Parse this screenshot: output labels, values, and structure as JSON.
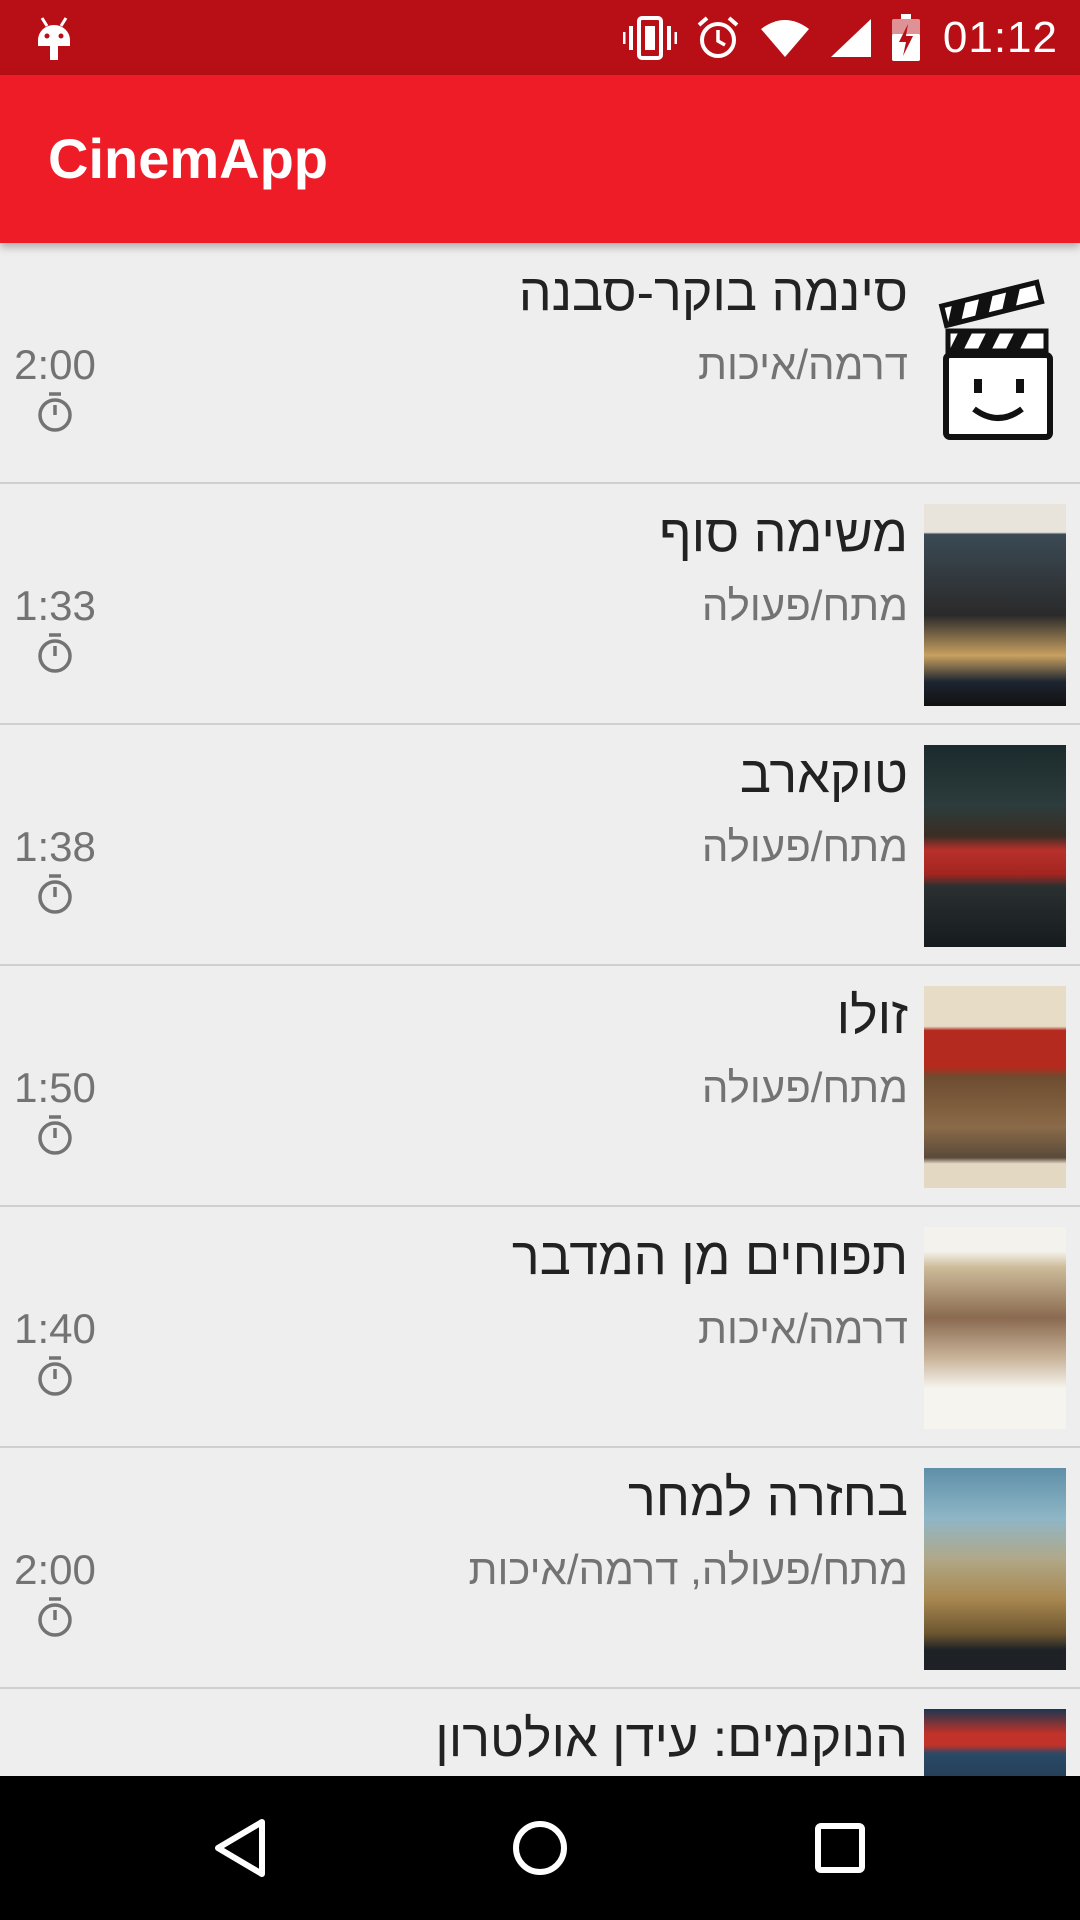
{
  "status_bar": {
    "time": "01:12",
    "icons": [
      "android-debug-icon",
      "vibrate-icon",
      "alarm-icon",
      "wifi-icon",
      "signal-icon",
      "battery-charging-icon"
    ],
    "color": "#b80f16"
  },
  "app_bar": {
    "title": "CinemApp",
    "color": "#ed1c27"
  },
  "movies": [
    {
      "title": "סינמה בוקר-סבנה",
      "genre": "דרמה/איכות",
      "duration": "2:00",
      "poster": "clapperboard-placeholder"
    },
    {
      "title": "משימה סוף",
      "genre": "מתח/פעולה",
      "duration": "1:33",
      "poster": "movie-poster"
    },
    {
      "title": "טוקארב",
      "genre": "מתח/פעולה",
      "duration": "1:38",
      "poster": "movie-poster"
    },
    {
      "title": "זולו",
      "genre": "מתח/פעולה",
      "duration": "1:50",
      "poster": "movie-poster"
    },
    {
      "title": "תפוחים מן המדבר",
      "genre": "דרמה/איכות",
      "duration": "1:40",
      "poster": "movie-poster"
    },
    {
      "title": "בחזרה למחר",
      "genre": "מתח/פעולה, דרמה/איכות",
      "duration": "2:00",
      "poster": "movie-poster"
    },
    {
      "title": "הנוקמים: עידן אולטרון",
      "genre": "",
      "duration": "",
      "poster": "movie-poster"
    }
  ],
  "nav_bar": {
    "icons": [
      "back-icon",
      "home-icon",
      "recents-icon"
    ]
  }
}
